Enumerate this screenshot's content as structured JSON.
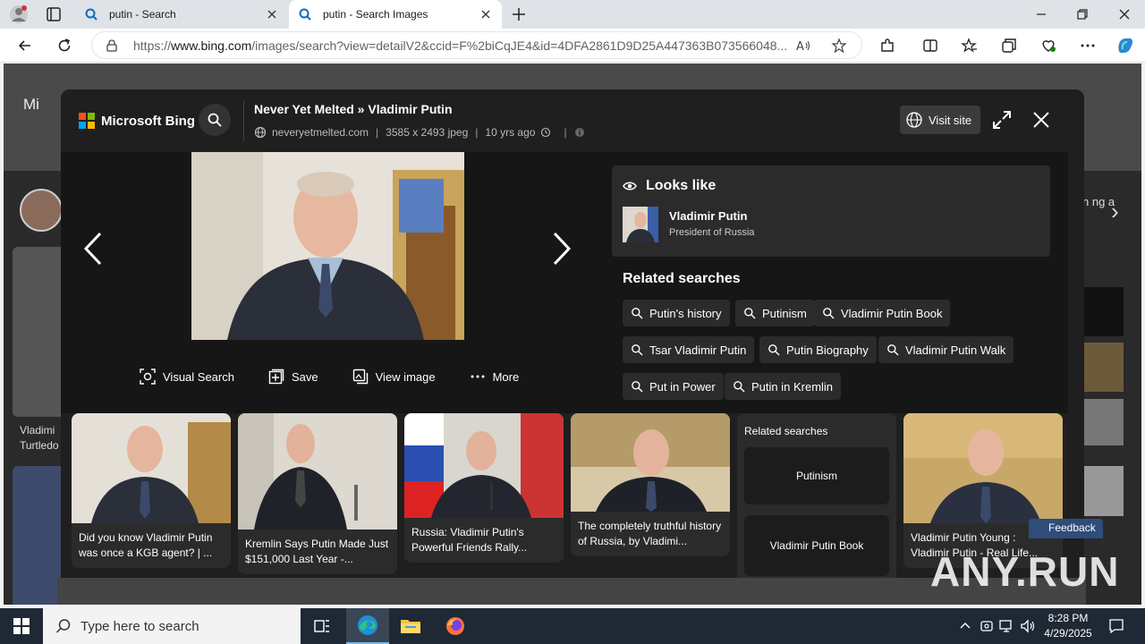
{
  "browser": {
    "tabs": [
      {
        "title": "putin - Search",
        "active": false
      },
      {
        "title": "putin - Search Images",
        "active": true
      }
    ],
    "url_prefix": "https://",
    "url_domain": "www.bing.com",
    "url_rest": "/images/search?view=detailV2&ccid=F%2biCqJE4&id=4DFA2861D9D25A447363B073566048..."
  },
  "background": {
    "brand_fragment": "Mi",
    "left_caption": "Vladimi Turtledo",
    "right_snippet": "n ng a",
    "feedback": "Feedback"
  },
  "viewer": {
    "brand": "Microsoft Bing",
    "title_source": "Never Yet Melted",
    "title_sep": " » ",
    "title_subject": "Vladimir Putin",
    "domain": "neveryetmelted.com",
    "dimensions": "3585 x 2493 jpeg",
    "age": "10 yrs ago",
    "visit_site": "Visit site",
    "actions": {
      "visual_search": "Visual Search",
      "save": "Save",
      "view_image": "View image",
      "more": "More"
    },
    "looks_like": {
      "heading": "Looks like",
      "name": "Vladimir Putin",
      "subtitle": "President of Russia"
    },
    "related": {
      "heading": "Related searches",
      "chips": [
        "Putin's history",
        "Putinism",
        "Vladimir Putin Book",
        "Tsar Vladimir Putin",
        "Putin Biography",
        "Vladimir Putin Walk",
        "Put in Power",
        "Putin in Kremlin"
      ]
    },
    "thumbnails": [
      {
        "caption": "Did you know Vladimir Putin was once a KGB agent? | ..."
      },
      {
        "caption": "Kremlin Says Putin Made Just $151,000 Last Year -..."
      },
      {
        "caption": "Russia: Vladimir Putin's Powerful Friends Rally..."
      },
      {
        "caption": "The completely truthful history of Russia, by Vladimi..."
      },
      {
        "caption": "Vladimir Putin Young : Vladimir Putin - Real Life..."
      }
    ],
    "related_card": {
      "heading": "Related searches",
      "items": [
        "Putinism",
        "Vladimir Putin Book"
      ]
    }
  },
  "watermark": "ANY.RUN",
  "taskbar": {
    "search_placeholder": "Type here to search",
    "time": "8:28 PM",
    "date": "4/29/2025"
  }
}
